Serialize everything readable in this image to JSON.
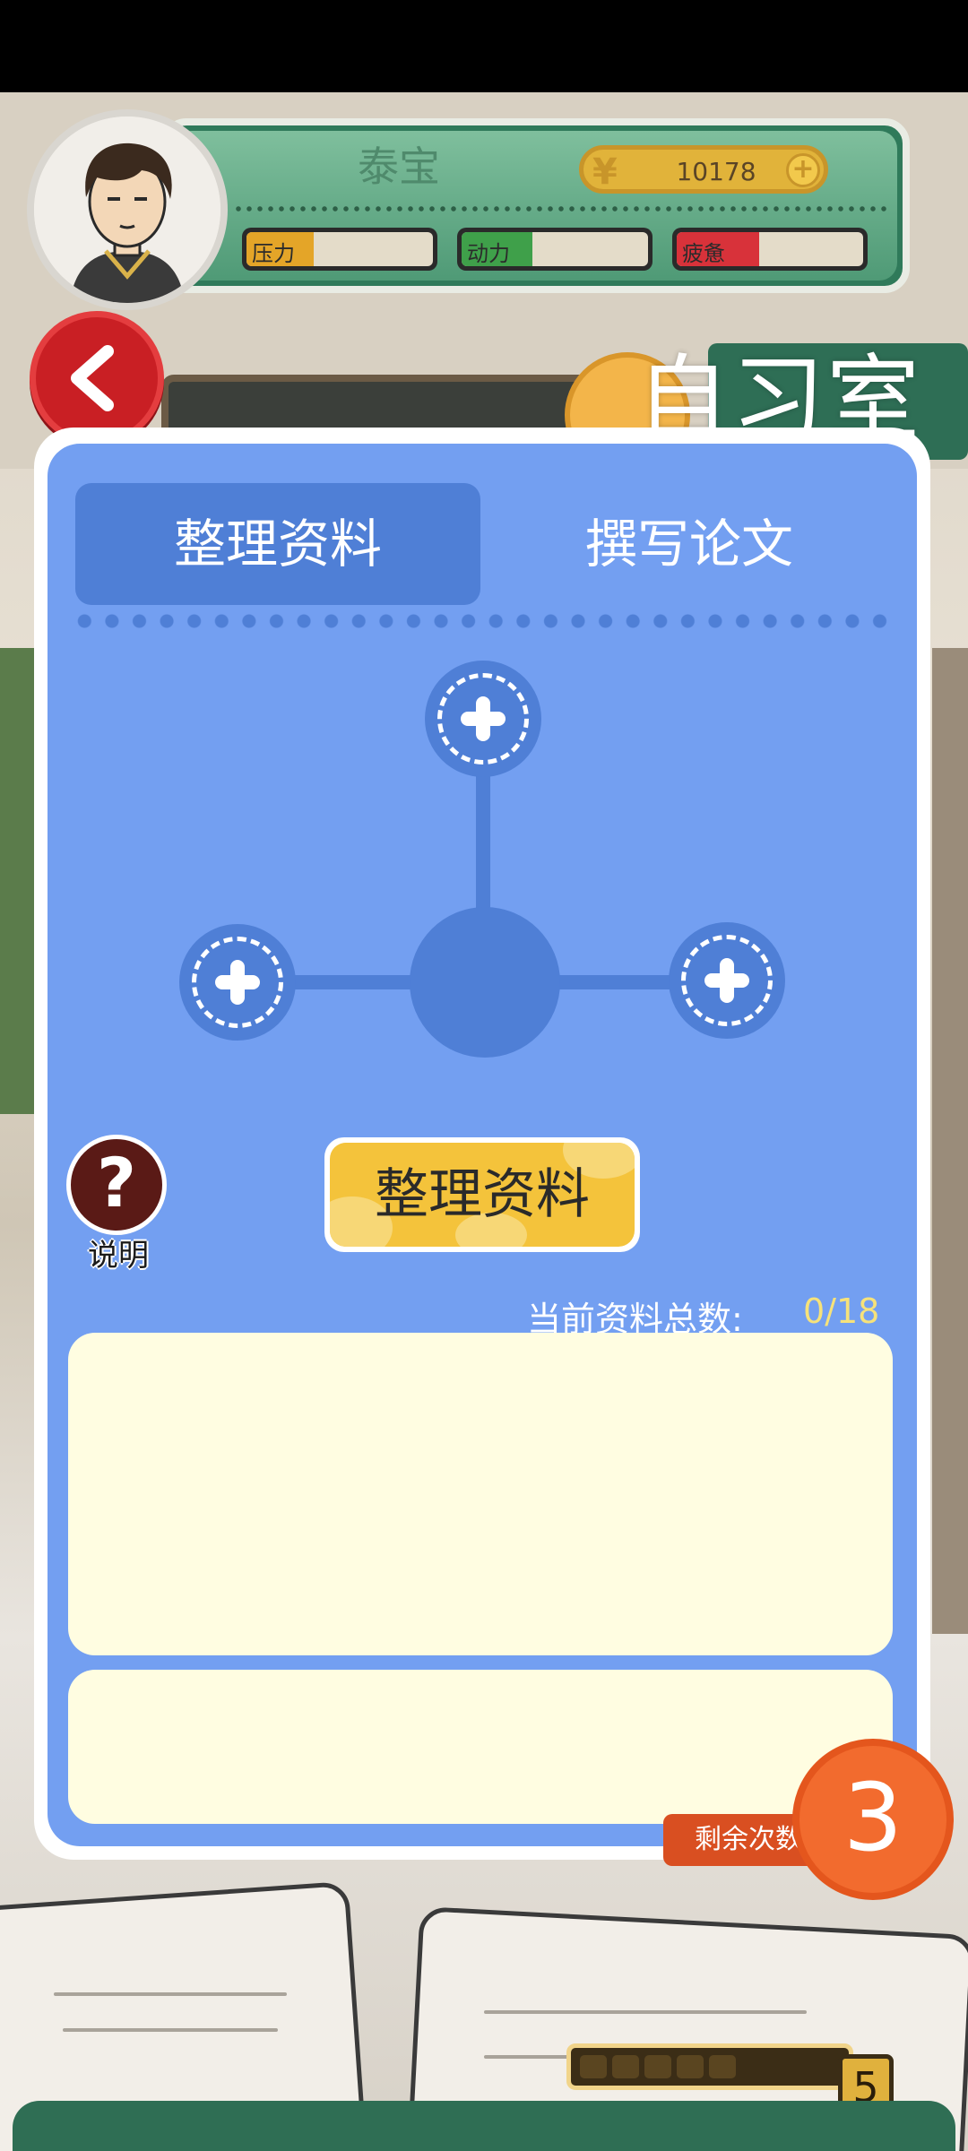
{
  "hud": {
    "player_name": "泰宝",
    "coins": "10178",
    "stats": {
      "pressure": {
        "label": "压力",
        "level": 0.36
      },
      "motivation": {
        "label": "动力",
        "level": 0.38
      },
      "fatigue": {
        "label": "疲惫",
        "level": 0.44
      }
    }
  },
  "header": {
    "title": "自习室",
    "back_icon": "chevron-left-icon"
  },
  "tabs": [
    {
      "label": "整理资料",
      "active": true
    },
    {
      "label": "撰写论文",
      "active": false
    }
  ],
  "slots": {
    "icon": "plus-icon",
    "count": 3
  },
  "help": {
    "glyph": "?",
    "label": "说明"
  },
  "actions": {
    "organize_label": "整理资料"
  },
  "materials": {
    "label": "当前资料总数:",
    "value": "0/18"
  },
  "remaining": {
    "label": "剩余次数",
    "count": "3"
  },
  "energy": {
    "count": "5"
  },
  "colors": {
    "panel_blue": "#739ff1",
    "accent_blue": "#4f7fd6",
    "button_yellow": "#f4c33b",
    "remaining_orange": "#f26b2e",
    "back_red": "#c91f24"
  }
}
